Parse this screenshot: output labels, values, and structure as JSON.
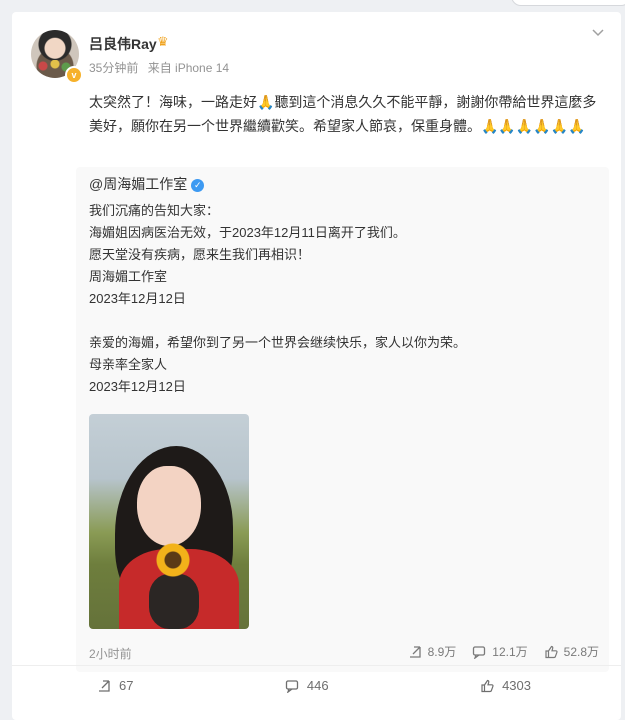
{
  "post": {
    "username": "吕良伟Ray",
    "time": "35分钟前",
    "source": "来自 iPhone 14",
    "text_parts": [
      "太突然了！海味，一路走好",
      "聽到這个消息久久不能平靜，謝謝你帶給世界這麼多美好，願你在另一个世界繼續歡笑。希望家人節哀，保重身體。",
      "🙏🙏🙏🙏🙏🙏"
    ],
    "pray_inline": "🙏"
  },
  "repost": {
    "username": "@周海媚工作室",
    "lines": [
      "我们沉痛的告知大家：",
      "海媚姐因病医治无效，于2023年12月11日离开了我们。",
      "愿天堂没有疾病，愿来生我们再相识！",
      "周海媚工作室",
      "2023年12月12日",
      "",
      "亲爱的海媚，希望你到了另一个世界会继续快乐，家人以你为荣。",
      "母亲率全家人",
      "2023年12月12日"
    ],
    "time": "2小时前",
    "stats": {
      "reposts": "8.9万",
      "comments": "12.1万",
      "likes": "52.8万"
    }
  },
  "actions": {
    "reposts": "67",
    "comments": "446",
    "likes": "4303"
  },
  "colors": {
    "accent": "#f0a21c",
    "verified_blue": "#3d9af2",
    "muted": "#939393"
  },
  "icons": [
    "chevron-down-icon",
    "crown-icon",
    "verified-badge-icon",
    "repost-icon",
    "comment-icon",
    "like-icon"
  ]
}
